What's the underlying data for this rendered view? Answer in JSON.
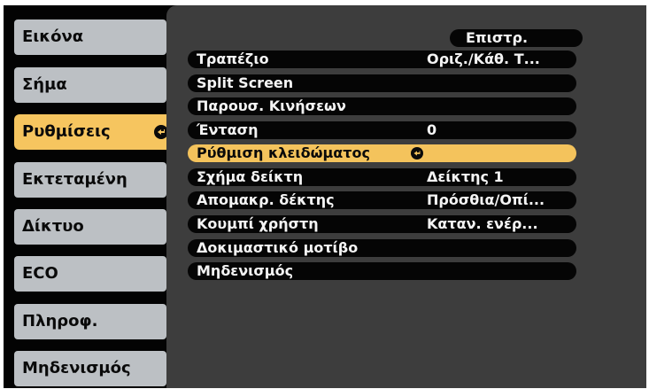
{
  "sidebar": {
    "items": [
      {
        "label": "Εικόνα",
        "active": false
      },
      {
        "label": "Σήμα",
        "active": false
      },
      {
        "label": "Ρυθμίσεις",
        "active": true,
        "icon": "enter-icon"
      },
      {
        "label": "Εκτεταμένη",
        "active": false
      },
      {
        "label": "Δίκτυο",
        "active": false
      },
      {
        "label": "ECO",
        "active": false
      },
      {
        "label": "Πληροφ.",
        "active": false
      },
      {
        "label": "Μηδενισμός",
        "active": false
      }
    ]
  },
  "menu": {
    "back_label": "Επιστρ.",
    "rows": [
      {
        "label": "Τραπέζιο",
        "value": "Οριζ./Κάθ. Τ..."
      },
      {
        "label": "Split Screen",
        "value": ""
      },
      {
        "label": "Παρουσ. Κινήσεων",
        "value": ""
      },
      {
        "label": "Ένταση",
        "value": "0"
      },
      {
        "label": "Ρύθμιση κλειδώματος",
        "value": "",
        "selected": true,
        "icon": "enter-icon"
      },
      {
        "label": "Σχήμα δείκτη",
        "value": "Δείκτης 1"
      },
      {
        "label": "Απομακρ. δέκτης",
        "value": "Πρόσθια/Οπί..."
      },
      {
        "label": "Κουμπί χρήστη",
        "value": "Καταν. ενέρ..."
      },
      {
        "label": "Δοκιμαστικό μοτίβο",
        "value": ""
      },
      {
        "label": "Μηδενισμός",
        "value": ""
      }
    ]
  },
  "colors": {
    "screen_bg": "#030303",
    "panel_bg": "#3d3d3d",
    "tab_bg": "#bcc0c4",
    "highlight": "#f4c35c",
    "row_bg": "#050505",
    "text_light": "#f4f4f4",
    "text_dark": "#0a0a0a"
  }
}
